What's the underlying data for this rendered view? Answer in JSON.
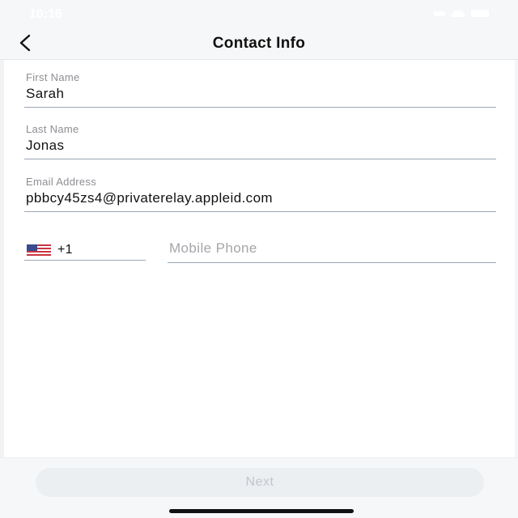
{
  "status_bar": {
    "time": "10:16"
  },
  "nav": {
    "title": "Contact Info",
    "back_icon": "chevron-left-icon"
  },
  "form": {
    "first_name": {
      "label": "First Name",
      "value": "Sarah"
    },
    "last_name": {
      "label": "Last Name",
      "value": "Jonas"
    },
    "email": {
      "label": "Email Address",
      "value": "pbbcy45zs4@privaterelay.appleid.com"
    },
    "phone": {
      "country_flag": "us-flag-icon",
      "country_code": "+1",
      "placeholder": "Mobile Phone",
      "value": ""
    }
  },
  "footer": {
    "next_label": "Next"
  },
  "colors": {
    "underline": "#9aa7b5",
    "label": "#8c8e92",
    "bar_background": "#f6f7f8",
    "button_disabled_bg": "#eceff2",
    "button_disabled_text": "#c2c5ca"
  }
}
